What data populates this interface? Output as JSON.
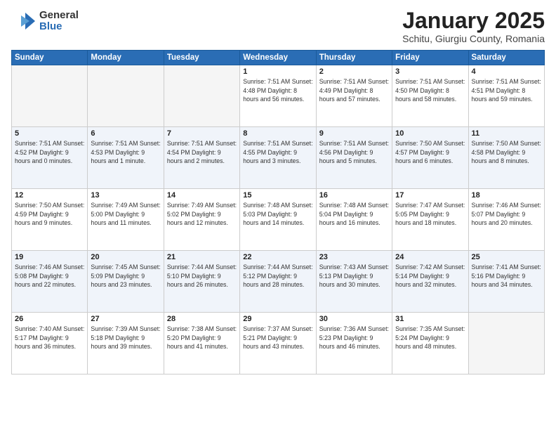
{
  "header": {
    "logo_general": "General",
    "logo_blue": "Blue",
    "month": "January 2025",
    "location": "Schitu, Giurgiu County, Romania"
  },
  "weekdays": [
    "Sunday",
    "Monday",
    "Tuesday",
    "Wednesday",
    "Thursday",
    "Friday",
    "Saturday"
  ],
  "weeks": [
    [
      {
        "day": "",
        "info": ""
      },
      {
        "day": "",
        "info": ""
      },
      {
        "day": "",
        "info": ""
      },
      {
        "day": "1",
        "info": "Sunrise: 7:51 AM\nSunset: 4:48 PM\nDaylight: 8 hours and 56 minutes."
      },
      {
        "day": "2",
        "info": "Sunrise: 7:51 AM\nSunset: 4:49 PM\nDaylight: 8 hours and 57 minutes."
      },
      {
        "day": "3",
        "info": "Sunrise: 7:51 AM\nSunset: 4:50 PM\nDaylight: 8 hours and 58 minutes."
      },
      {
        "day": "4",
        "info": "Sunrise: 7:51 AM\nSunset: 4:51 PM\nDaylight: 8 hours and 59 minutes."
      }
    ],
    [
      {
        "day": "5",
        "info": "Sunrise: 7:51 AM\nSunset: 4:52 PM\nDaylight: 9 hours and 0 minutes."
      },
      {
        "day": "6",
        "info": "Sunrise: 7:51 AM\nSunset: 4:53 PM\nDaylight: 9 hours and 1 minute."
      },
      {
        "day": "7",
        "info": "Sunrise: 7:51 AM\nSunset: 4:54 PM\nDaylight: 9 hours and 2 minutes."
      },
      {
        "day": "8",
        "info": "Sunrise: 7:51 AM\nSunset: 4:55 PM\nDaylight: 9 hours and 3 minutes."
      },
      {
        "day": "9",
        "info": "Sunrise: 7:51 AM\nSunset: 4:56 PM\nDaylight: 9 hours and 5 minutes."
      },
      {
        "day": "10",
        "info": "Sunrise: 7:50 AM\nSunset: 4:57 PM\nDaylight: 9 hours and 6 minutes."
      },
      {
        "day": "11",
        "info": "Sunrise: 7:50 AM\nSunset: 4:58 PM\nDaylight: 9 hours and 8 minutes."
      }
    ],
    [
      {
        "day": "12",
        "info": "Sunrise: 7:50 AM\nSunset: 4:59 PM\nDaylight: 9 hours and 9 minutes."
      },
      {
        "day": "13",
        "info": "Sunrise: 7:49 AM\nSunset: 5:00 PM\nDaylight: 9 hours and 11 minutes."
      },
      {
        "day": "14",
        "info": "Sunrise: 7:49 AM\nSunset: 5:02 PM\nDaylight: 9 hours and 12 minutes."
      },
      {
        "day": "15",
        "info": "Sunrise: 7:48 AM\nSunset: 5:03 PM\nDaylight: 9 hours and 14 minutes."
      },
      {
        "day": "16",
        "info": "Sunrise: 7:48 AM\nSunset: 5:04 PM\nDaylight: 9 hours and 16 minutes."
      },
      {
        "day": "17",
        "info": "Sunrise: 7:47 AM\nSunset: 5:05 PM\nDaylight: 9 hours and 18 minutes."
      },
      {
        "day": "18",
        "info": "Sunrise: 7:46 AM\nSunset: 5:07 PM\nDaylight: 9 hours and 20 minutes."
      }
    ],
    [
      {
        "day": "19",
        "info": "Sunrise: 7:46 AM\nSunset: 5:08 PM\nDaylight: 9 hours and 22 minutes."
      },
      {
        "day": "20",
        "info": "Sunrise: 7:45 AM\nSunset: 5:09 PM\nDaylight: 9 hours and 23 minutes."
      },
      {
        "day": "21",
        "info": "Sunrise: 7:44 AM\nSunset: 5:10 PM\nDaylight: 9 hours and 26 minutes."
      },
      {
        "day": "22",
        "info": "Sunrise: 7:44 AM\nSunset: 5:12 PM\nDaylight: 9 hours and 28 minutes."
      },
      {
        "day": "23",
        "info": "Sunrise: 7:43 AM\nSunset: 5:13 PM\nDaylight: 9 hours and 30 minutes."
      },
      {
        "day": "24",
        "info": "Sunrise: 7:42 AM\nSunset: 5:14 PM\nDaylight: 9 hours and 32 minutes."
      },
      {
        "day": "25",
        "info": "Sunrise: 7:41 AM\nSunset: 5:16 PM\nDaylight: 9 hours and 34 minutes."
      }
    ],
    [
      {
        "day": "26",
        "info": "Sunrise: 7:40 AM\nSunset: 5:17 PM\nDaylight: 9 hours and 36 minutes."
      },
      {
        "day": "27",
        "info": "Sunrise: 7:39 AM\nSunset: 5:18 PM\nDaylight: 9 hours and 39 minutes."
      },
      {
        "day": "28",
        "info": "Sunrise: 7:38 AM\nSunset: 5:20 PM\nDaylight: 9 hours and 41 minutes."
      },
      {
        "day": "29",
        "info": "Sunrise: 7:37 AM\nSunset: 5:21 PM\nDaylight: 9 hours and 43 minutes."
      },
      {
        "day": "30",
        "info": "Sunrise: 7:36 AM\nSunset: 5:23 PM\nDaylight: 9 hours and 46 minutes."
      },
      {
        "day": "31",
        "info": "Sunrise: 7:35 AM\nSunset: 5:24 PM\nDaylight: 9 hours and 48 minutes."
      },
      {
        "day": "",
        "info": ""
      }
    ]
  ]
}
